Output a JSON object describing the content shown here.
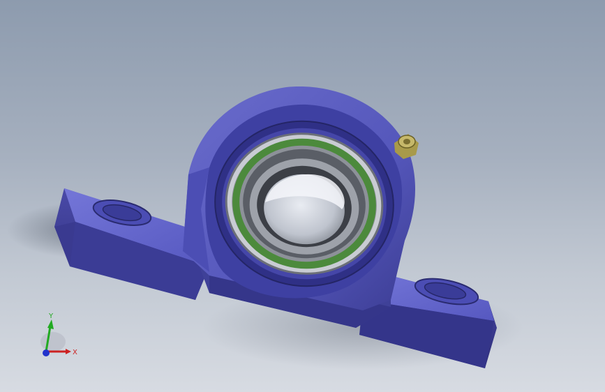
{
  "viewport": {
    "background_top": "#8d9bae",
    "background_bottom": "#d7dbe2"
  },
  "model": {
    "part": "pillow-block-bearing",
    "housing_color": "#5a5cc2",
    "bearing_ring_color": "#6c7078",
    "seal_color": "#4c8a3c",
    "grease_fitting_color": "#c6b86a"
  },
  "triad": {
    "x_label": "X",
    "y_label": "Y",
    "x_color": "#cc2222",
    "y_color": "#22aa22",
    "z_color": "#2233cc"
  }
}
